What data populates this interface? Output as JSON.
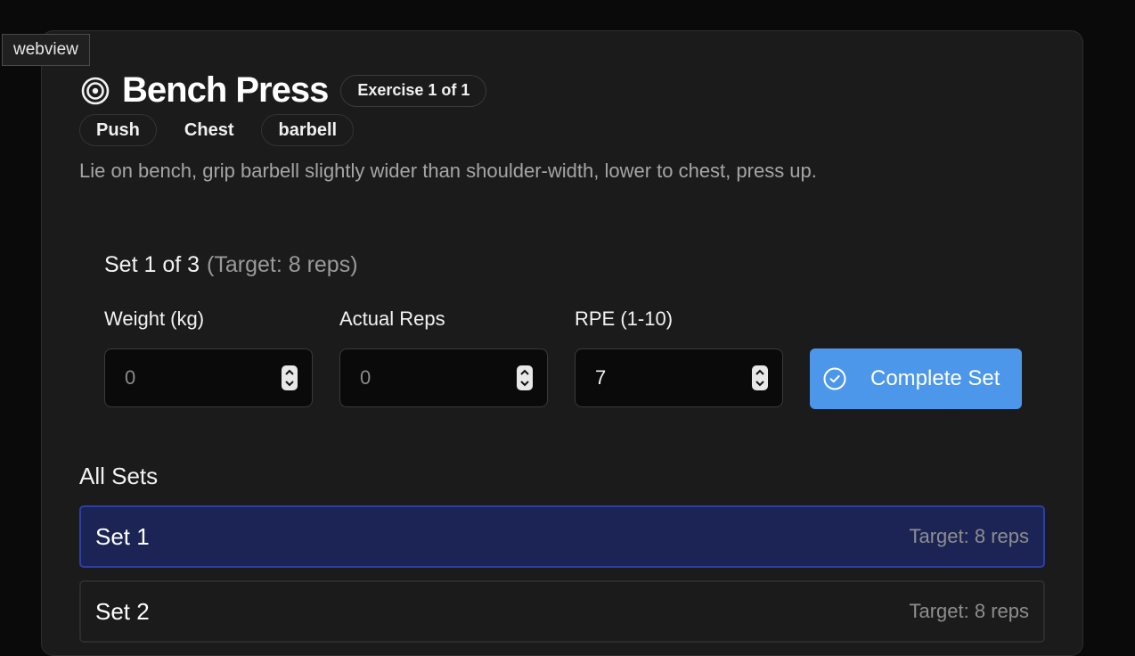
{
  "webview_label": "webview",
  "exercise": {
    "title": "Bench Press",
    "badge": "Exercise 1 of 1",
    "tags": [
      "Push",
      "Chest",
      "barbell"
    ],
    "description": "Lie on bench, grip barbell slightly wider than shoulder-width, lower to chest, press up."
  },
  "current_set": {
    "heading": "Set 1 of 3",
    "target": "(Target: 8 reps)"
  },
  "fields": {
    "weight": {
      "label": "Weight (kg)",
      "placeholder": "0",
      "value": ""
    },
    "reps": {
      "label": "Actual Reps",
      "placeholder": "0",
      "value": ""
    },
    "rpe": {
      "label": "RPE (1-10)",
      "placeholder": "",
      "value": "7"
    }
  },
  "complete_button": {
    "label": "Complete Set",
    "icon": "check-circle-icon"
  },
  "all_sets": {
    "title": "All Sets",
    "rows": [
      {
        "name": "Set 1",
        "target": "Target: 8 reps",
        "active": true
      },
      {
        "name": "Set 2",
        "target": "Target: 8 reps",
        "active": false
      }
    ]
  },
  "colors": {
    "background": "#0a0a0a",
    "card": "#1b1b1b",
    "accent_button": "#4c97ea",
    "active_row": "#1b2455",
    "active_row_border": "#2e3fa3"
  }
}
